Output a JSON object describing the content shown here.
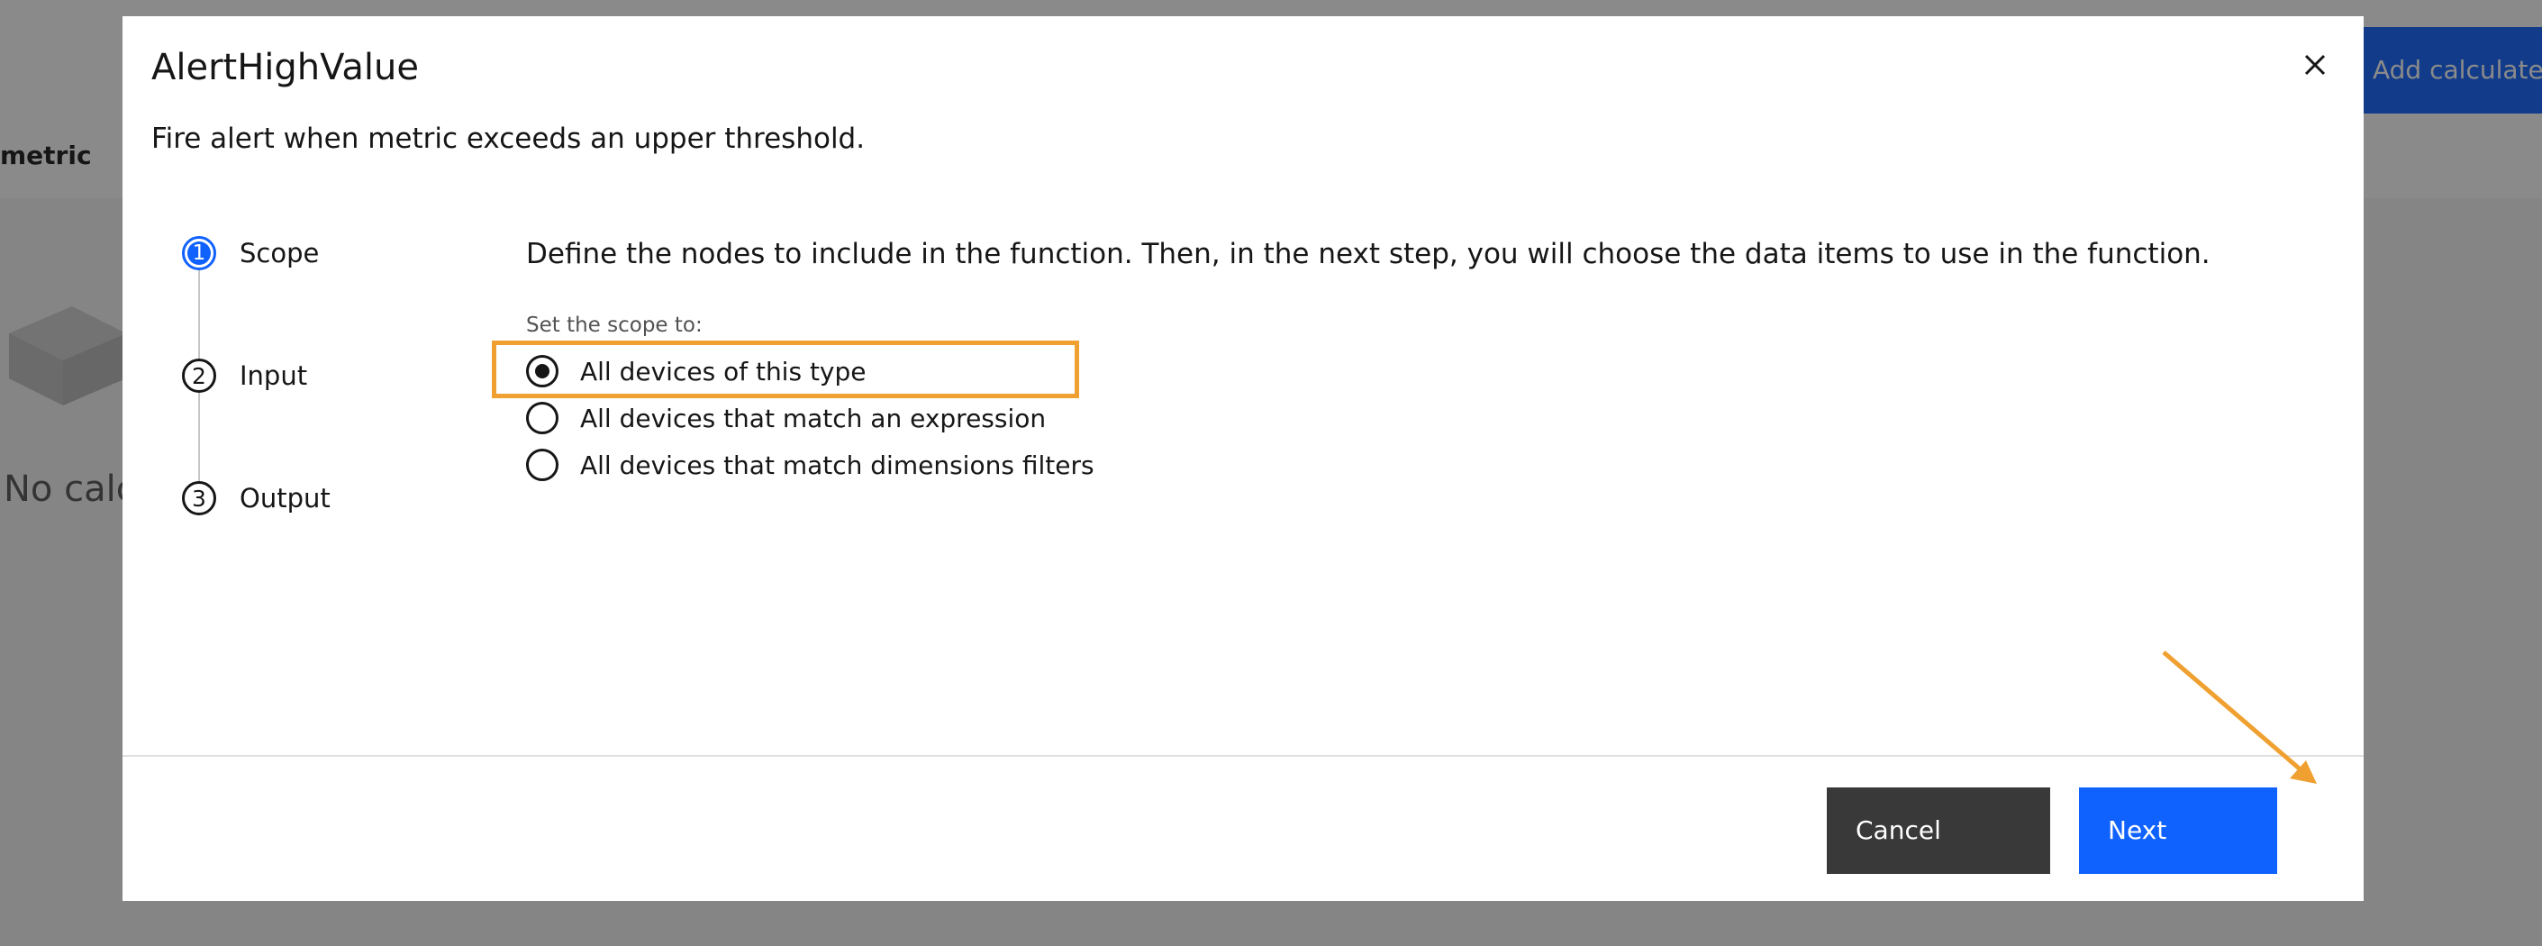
{
  "background": {
    "add_button_label": "Add calculated metric",
    "tab_label": "metric",
    "empty_state_text": "No calculated metrics"
  },
  "modal": {
    "title": "AlertHighValue",
    "description": "Fire alert when metric exceeds an upper threshold.",
    "steps": [
      {
        "number": "1",
        "label": "Scope",
        "state": "current"
      },
      {
        "number": "2",
        "label": "Input",
        "state": "incomplete"
      },
      {
        "number": "3",
        "label": "Output",
        "state": "incomplete"
      }
    ],
    "content": {
      "intro": "Define the nodes to include in the function. Then, in the next step, you will choose the data items to use in the function.",
      "scope_legend": "Set the scope to:",
      "options": [
        {
          "label": "All devices of this type",
          "selected": true
        },
        {
          "label": "All devices that match an expression",
          "selected": false
        },
        {
          "label": "All devices that match dimensions filters",
          "selected": false
        }
      ]
    },
    "footer": {
      "cancel_label": "Cancel",
      "next_label": "Next"
    }
  },
  "colors": {
    "primary": "#0f62fe",
    "secondary_button": "#393939",
    "annotation": "#f0a030",
    "overlay": "rgba(22,22,22,0.5)"
  }
}
